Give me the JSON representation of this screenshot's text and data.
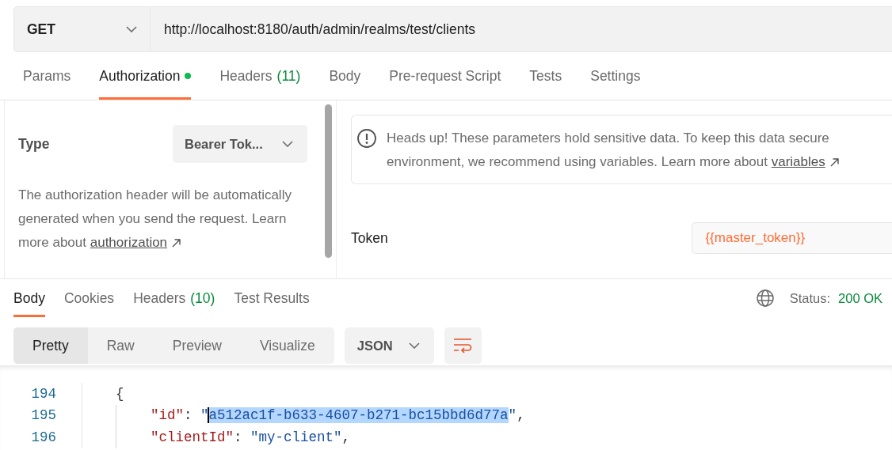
{
  "request": {
    "method": "GET",
    "url": "http://localhost:8180/auth/admin/realms/test/clients"
  },
  "request_tabs": [
    {
      "label": "Params",
      "selected": false,
      "indicator": false
    },
    {
      "label": "Authorization",
      "selected": true,
      "indicator": true
    },
    {
      "label": "Headers",
      "count": "(11)",
      "selected": false,
      "indicator": false
    },
    {
      "label": "Body",
      "selected": false,
      "indicator": false
    },
    {
      "label": "Pre-request Script",
      "selected": false,
      "indicator": false
    },
    {
      "label": "Tests",
      "selected": false,
      "indicator": false
    },
    {
      "label": "Settings",
      "selected": false,
      "indicator": false
    }
  ],
  "auth": {
    "type_label": "Type",
    "type_value": "Bearer Tok...",
    "description": "The authorization header will be automatically generated when you send the request. Learn more about",
    "description_link": "authorization",
    "notice": "Heads up! These parameters hold sensitive data. To keep this data secure",
    "notice_cont": "environment, we recommend using variables. Learn more about",
    "notice_link": "variables",
    "token_label": "Token",
    "token_value": "{{master_token}}"
  },
  "response": {
    "tabs": [
      {
        "label": "Body",
        "selected": true
      },
      {
        "label": "Cookies",
        "selected": false
      },
      {
        "label": "Headers",
        "count": "(10)",
        "selected": false
      },
      {
        "label": "Test Results",
        "selected": false
      }
    ],
    "status_label": "Status:",
    "status_value": "200 OK",
    "view_modes": [
      {
        "label": "Pretty",
        "selected": true
      },
      {
        "label": "Raw",
        "selected": false
      },
      {
        "label": "Preview",
        "selected": false
      },
      {
        "label": "Visualize",
        "selected": false
      }
    ],
    "format": "JSON",
    "code": [
      {
        "number": "194",
        "parts": [
          {
            "kind": "punct",
            "text": "{",
            "selected": false
          }
        ],
        "children": [
          {
            "number": "195",
            "parts": [
              {
                "kind": "key",
                "text": "\"id\"",
                "selected": false
              },
              {
                "kind": "punct",
                "text": ": ",
                "selected": false
              },
              {
                "kind": "string",
                "text": "\"",
                "selected": false
              },
              {
                "kind": "string",
                "text": "a512ac1f-b633-4607-b271-bc15bbd6d77a",
                "selected": true
              },
              {
                "kind": "string",
                "text": "\"",
                "selected": false
              },
              {
                "kind": "punct",
                "text": ",",
                "selected": false
              }
            ]
          },
          {
            "number": "196",
            "parts": [
              {
                "kind": "key",
                "text": "\"clientId\"",
                "selected": false
              },
              {
                "kind": "punct",
                "text": ": ",
                "selected": false
              },
              {
                "kind": "string",
                "text": "\"my-client\"",
                "selected": false
              },
              {
                "kind": "punct",
                "text": ",",
                "selected": false
              }
            ]
          }
        ]
      }
    ]
  }
}
